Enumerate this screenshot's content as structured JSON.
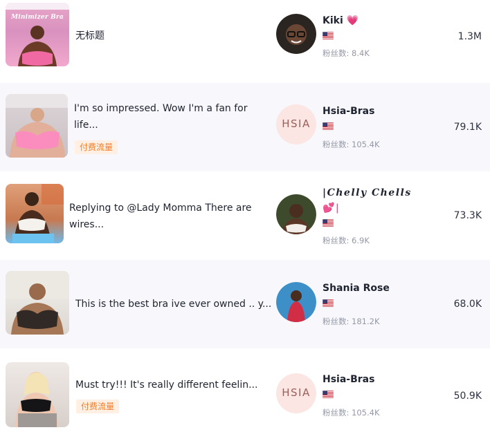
{
  "colors": {
    "row_alt_bg": "#f8f8fc",
    "tag_bg": "#fff0e3",
    "tag_text": "#f07d2c",
    "muted_text": "#9498a6",
    "heart": "#ff3d9a"
  },
  "rows": [
    {
      "title": "无标题",
      "thumb_caption": "Minimizer Bra",
      "creator_name": "Kiki",
      "creator_suffix": "💗",
      "flag": "us-flag-icon",
      "fans": "粉丝数: 8.4K",
      "value": "1.3M"
    },
    {
      "title_line1": "I'm so impressed. Wow I'm a fan for",
      "title_line2": "life...",
      "tag": "付费流量",
      "creator_name": "Hsia-Bras",
      "avatar_text": "HSIA",
      "flag": "us-flag-icon",
      "fans": "粉丝数: 105.4K",
      "value": "79.1K"
    },
    {
      "title_line1": "Replying to @Lady Momma There are",
      "title_line2": "wires...",
      "creator_name_line1": "|Chelly Chells",
      "creator_name_line2": "💕|",
      "flag": "us-flag-icon",
      "fans": "粉丝数: 6.9K",
      "value": "73.3K"
    },
    {
      "title": "This is the best bra ive ever owned .. y...",
      "creator_name": "Shania Rose",
      "flag": "us-flag-icon",
      "fans": "粉丝数: 181.2K",
      "value": "68.0K"
    },
    {
      "title": "Must try!!! It's really different feelin...",
      "tag": "付费流量",
      "creator_name": "Hsia-Bras",
      "avatar_text": "HSIA",
      "flag": "us-flag-icon",
      "fans": "粉丝数: 105.4K",
      "value": "50.9K"
    }
  ]
}
